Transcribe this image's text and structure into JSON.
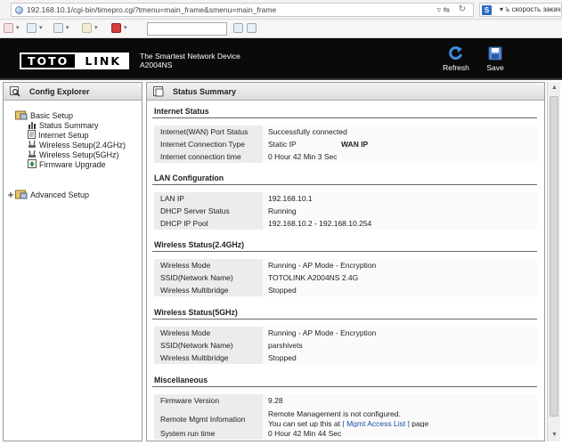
{
  "browser": {
    "url": "192.168.10.1/cgi-bin/timepro.cgi?tmenu=main_frame&smenu=main_frame",
    "url_tail": "▿ ⇋",
    "search_engine_letter": "S",
    "search_text": "▾ ъ скорость закач"
  },
  "header": {
    "logo_left": "TOTO",
    "logo_right": "LINK",
    "tagline": "The Smartest Network Device",
    "model": "A2004NS",
    "refresh_label": "Refresh",
    "save_label": "Save"
  },
  "explorer": {
    "title": "Config Explorer",
    "basic_setup": "Basic Setup",
    "items": [
      "Status Summary",
      "Internet Setup",
      "Wireless Setup(2.4GHz)",
      "Wireless Setup(5GHz)",
      "Firmware Upgrade"
    ],
    "advanced_setup": "Advanced Setup"
  },
  "main": {
    "title": "Status Summary",
    "internet": {
      "title": "Internet Status",
      "port_label": "Internet(WAN) Port Status",
      "port_value": "Successfully connected",
      "type_label": "Internet Connection Type",
      "type_value": "Static IP",
      "wan_ip": "WAN IP",
      "time_label": "Internet connection time",
      "time_value": "0 Hour 42 Min 3 Sec"
    },
    "lan": {
      "title": "LAN Configuration",
      "ip_label": "LAN IP",
      "ip_value": "192.168.10.1",
      "dhcp_label": "DHCP Server Status",
      "dhcp_value": "Running",
      "pool_label": "DHCP IP Pool",
      "pool_value": "192.168.10.2 - 192.168.10.254"
    },
    "wl24": {
      "title": "Wireless Status(2.4GHz)",
      "mode_label": "Wireless Mode",
      "mode_value": "Running - AP Mode - Encryption",
      "ssid_label": "SSID(Network Name)",
      "ssid_value": "TOTOLINK A2004NS 2.4G",
      "bridge_label": "Wireless Multibridge",
      "bridge_value": "Stopped"
    },
    "wl5": {
      "title": "Wireless Status(5GHz)",
      "mode_label": "Wireless Mode",
      "mode_value": "Running - AP Mode - Encryption",
      "ssid_label": "SSID(Network Name)",
      "ssid_value": "parshivets",
      "bridge_label": "Wireless Multibridge",
      "bridge_value": "Stopped"
    },
    "misc": {
      "title": "Miscellaneous",
      "fw_label": "Firmware Version",
      "fw_value": "9.28",
      "remote_label": "Remote Mgmt Infomation",
      "remote_line1": "Remote Management is not configured.",
      "remote_line2_pre": "You can set up this at",
      "remote_link": "[ Mgmt Access List ]",
      "remote_line2_post": "page",
      "runtime_label": "System run time",
      "runtime_value": "0 Hour 42 Min 44 Sec"
    }
  }
}
